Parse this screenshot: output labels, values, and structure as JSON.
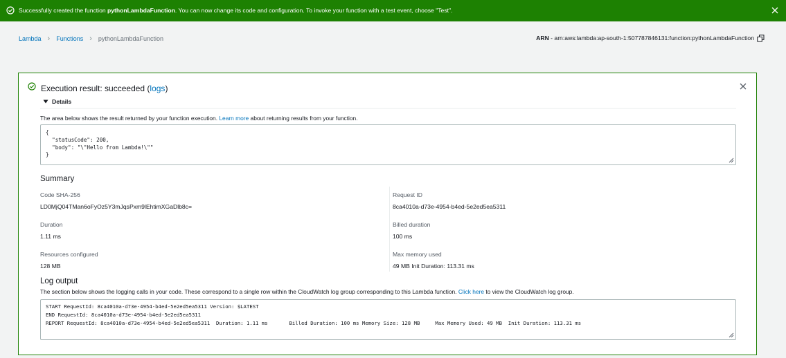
{
  "flash": {
    "prefix": "Successfully created the function ",
    "function_name": "pythonLambdaFunction",
    "suffix": ". You can now change its code and configuration. To invoke your function with a test event, choose \"Test\"."
  },
  "breadcrumb": {
    "items": [
      "Lambda",
      "Functions",
      "pythonLambdaFunction"
    ]
  },
  "arn": {
    "label": "ARN",
    "value": " - arn:aws:lambda:ap-south-1:507787846131:function:pythonLambdaFunction"
  },
  "execution": {
    "title_prefix": "Execution result: succeeded (",
    "logs_link": "logs",
    "title_suffix": ")",
    "details_label": "Details",
    "desc_prefix": "The area below shows the result returned by your function execution. ",
    "learn_more": "Learn more",
    "desc_suffix": " about returning results from your function.",
    "result": "{\n  \"statusCode\": 200,\n  \"body\": \"\\\"Hello from Lambda!\\\"\"\n}"
  },
  "summary": {
    "title": "Summary",
    "code_sha_label": "Code SHA-256",
    "code_sha_value": "LD0MjQ04TMan6oFyOz5Y3mJqsPxm9lEhtimXGaDlb8c=",
    "request_id_label": "Request ID",
    "request_id_value": "8ca4010a-d73e-4954-b4ed-5e2ed5ea5311",
    "duration_label": "Duration",
    "duration_value": "1.11 ms",
    "billed_label": "Billed duration",
    "billed_value": "100 ms",
    "resources_label": "Resources configured",
    "resources_value": "128 MB",
    "maxmem_label": "Max memory used",
    "maxmem_value": "49 MB Init Duration: 113.31 ms"
  },
  "log": {
    "title": "Log output",
    "desc_prefix": "The section below shows the logging calls in your code. These correspond to a single row within the CloudWatch log group corresponding to this Lambda function. ",
    "click_here": "Click here",
    "desc_suffix": " to view the CloudWatch log group.",
    "lines": "START RequestId: 8ca4010a-d73e-4954-b4ed-5e2ed5ea5311 Version: $LATEST\nEND RequestId: 8ca4010a-d73e-4954-b4ed-5e2ed5ea5311\nREPORT RequestId: 8ca4010a-d73e-4954-b4ed-5e2ed5ea5311  Duration: 1.11 ms       Billed Duration: 100 ms Memory Size: 128 MB     Max Memory Used: 49 MB  Init Duration: 113.31 ms"
  },
  "colors": {
    "success": "#1d8102",
    "link": "#0073bb"
  },
  "icons": {
    "flash_status": "check-circle-icon",
    "flash_close": "close-icon",
    "copy": "copy-icon",
    "panel_status": "check-circle-icon",
    "panel_close": "close-icon",
    "details": "caret-down-icon"
  }
}
